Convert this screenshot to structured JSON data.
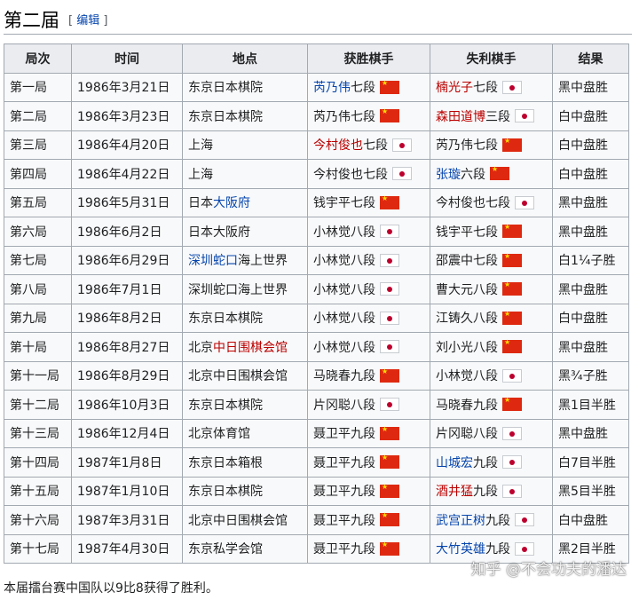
{
  "section": {
    "title": "第二届",
    "edit_bracket_open": "[",
    "edit_label": "编辑",
    "edit_bracket_close": "]"
  },
  "table": {
    "headers": [
      "局次",
      "时间",
      "地点",
      "获胜棋手",
      "失利棋手",
      "结果"
    ],
    "rows": [
      {
        "round": "第一局",
        "date": "1986年3月21日",
        "place": [
          {
            "t": "东京日本棋院"
          }
        ],
        "winner": {
          "parts": [
            {
              "t": "芮乃伟",
              "link": "blue"
            },
            {
              "t": "七段"
            }
          ],
          "flag": "cn"
        },
        "loser": {
          "parts": [
            {
              "t": "楠光子",
              "link": "red"
            },
            {
              "t": "七段"
            }
          ],
          "flag": "jp"
        },
        "result": "黑中盘胜"
      },
      {
        "round": "第二局",
        "date": "1986年3月23日",
        "place": [
          {
            "t": "东京日本棋院"
          }
        ],
        "winner": {
          "parts": [
            {
              "t": "芮乃伟七段"
            }
          ],
          "flag": "cn"
        },
        "loser": {
          "parts": [
            {
              "t": "森田道博",
              "link": "red"
            },
            {
              "t": "三段"
            }
          ],
          "flag": "jp"
        },
        "result": "白中盘胜"
      },
      {
        "round": "第三局",
        "date": "1986年4月20日",
        "place": [
          {
            "t": "上海"
          }
        ],
        "winner": {
          "parts": [
            {
              "t": "今村俊也",
              "link": "red"
            },
            {
              "t": "七段"
            }
          ],
          "flag": "jp"
        },
        "loser": {
          "parts": [
            {
              "t": "芮乃伟七段"
            }
          ],
          "flag": "cn"
        },
        "result": "白中盘胜"
      },
      {
        "round": "第四局",
        "date": "1986年4月22日",
        "place": [
          {
            "t": "上海"
          }
        ],
        "winner": {
          "parts": [
            {
              "t": "今村俊也七段"
            }
          ],
          "flag": "jp"
        },
        "loser": {
          "parts": [
            {
              "t": "张璇",
              "link": "blue"
            },
            {
              "t": "六段"
            }
          ],
          "flag": "cn"
        },
        "result": "白中盘胜"
      },
      {
        "round": "第五局",
        "date": "1986年5月31日",
        "place": [
          {
            "t": "日本"
          },
          {
            "t": "大阪府",
            "link": "blue"
          }
        ],
        "winner": {
          "parts": [
            {
              "t": "钱宇平七段"
            }
          ],
          "flag": "cn"
        },
        "loser": {
          "parts": [
            {
              "t": "今村俊也七段"
            }
          ],
          "flag": "jp"
        },
        "result": "黑中盘胜"
      },
      {
        "round": "第六局",
        "date": "1986年6月2日",
        "place": [
          {
            "t": "日本大阪府"
          }
        ],
        "winner": {
          "parts": [
            {
              "t": "小林觉八段"
            }
          ],
          "flag": "jp"
        },
        "loser": {
          "parts": [
            {
              "t": "钱宇平七段"
            }
          ],
          "flag": "cn"
        },
        "result": "黑中盘胜"
      },
      {
        "round": "第七局",
        "date": "1986年6月29日",
        "place": [
          {
            "t": "深圳",
            "link": "blue"
          },
          {
            "t": "蛇口",
            "link": "blue"
          },
          {
            "t": "海上世界"
          }
        ],
        "winner": {
          "parts": [
            {
              "t": "小林觉八段"
            }
          ],
          "flag": "jp"
        },
        "loser": {
          "parts": [
            {
              "t": "邵震中七段"
            }
          ],
          "flag": "cn"
        },
        "result": "白1¼子胜"
      },
      {
        "round": "第八局",
        "date": "1986年7月1日",
        "place": [
          {
            "t": "深圳蛇口海上世界"
          }
        ],
        "winner": {
          "parts": [
            {
              "t": "小林觉八段"
            }
          ],
          "flag": "jp"
        },
        "loser": {
          "parts": [
            {
              "t": "曹大元八段"
            }
          ],
          "flag": "cn"
        },
        "result": "黑中盘胜"
      },
      {
        "round": "第九局",
        "date": "1986年8月2日",
        "place": [
          {
            "t": "东京日本棋院"
          }
        ],
        "winner": {
          "parts": [
            {
              "t": "小林觉八段"
            }
          ],
          "flag": "jp"
        },
        "loser": {
          "parts": [
            {
              "t": "江铸久八段"
            }
          ],
          "flag": "cn"
        },
        "result": "白中盘胜"
      },
      {
        "round": "第十局",
        "date": "1986年8月27日",
        "place": [
          {
            "t": "北京"
          },
          {
            "t": "中日围棋会馆",
            "link": "red"
          }
        ],
        "winner": {
          "parts": [
            {
              "t": "小林觉八段"
            }
          ],
          "flag": "jp"
        },
        "loser": {
          "parts": [
            {
              "t": "刘小光八段"
            }
          ],
          "flag": "cn"
        },
        "result": "黑中盘胜"
      },
      {
        "round": "第十一局",
        "date": "1986年8月29日",
        "place": [
          {
            "t": "北京中日围棋会馆"
          }
        ],
        "winner": {
          "parts": [
            {
              "t": "马晓春九段"
            }
          ],
          "flag": "cn"
        },
        "loser": {
          "parts": [
            {
              "t": "小林觉八段"
            }
          ],
          "flag": "jp"
        },
        "result": "黑¾子胜"
      },
      {
        "round": "第十二局",
        "date": "1986年10月3日",
        "place": [
          {
            "t": "东京日本棋院"
          }
        ],
        "winner": {
          "parts": [
            {
              "t": "片冈聪八段"
            }
          ],
          "flag": "jp"
        },
        "loser": {
          "parts": [
            {
              "t": "马晓春九段"
            }
          ],
          "flag": "cn"
        },
        "result": "黑1目半胜"
      },
      {
        "round": "第十三局",
        "date": "1986年12月4日",
        "place": [
          {
            "t": "北京体育馆"
          }
        ],
        "winner": {
          "parts": [
            {
              "t": "聂卫平九段"
            }
          ],
          "flag": "cn"
        },
        "loser": {
          "parts": [
            {
              "t": "片冈聪八段"
            }
          ],
          "flag": "jp"
        },
        "result": "黑中盘胜"
      },
      {
        "round": "第十四局",
        "date": "1987年1月8日",
        "place": [
          {
            "t": "东京日本箱根"
          }
        ],
        "winner": {
          "parts": [
            {
              "t": "聂卫平九段"
            }
          ],
          "flag": "cn"
        },
        "loser": {
          "parts": [
            {
              "t": "山城宏",
              "link": "blue"
            },
            {
              "t": "九段"
            }
          ],
          "flag": "jp"
        },
        "result": "白7目半胜"
      },
      {
        "round": "第十五局",
        "date": "1987年1月10日",
        "place": [
          {
            "t": "东京日本棋院"
          }
        ],
        "winner": {
          "parts": [
            {
              "t": "聂卫平九段"
            }
          ],
          "flag": "cn"
        },
        "loser": {
          "parts": [
            {
              "t": "酒井猛",
              "link": "red"
            },
            {
              "t": "九段"
            }
          ],
          "flag": "jp"
        },
        "result": "黑5目半胜"
      },
      {
        "round": "第十六局",
        "date": "1987年3月31日",
        "place": [
          {
            "t": "北京中日围棋会馆"
          }
        ],
        "winner": {
          "parts": [
            {
              "t": "聂卫平九段"
            }
          ],
          "flag": "cn"
        },
        "loser": {
          "parts": [
            {
              "t": "武宫正树",
              "link": "blue"
            },
            {
              "t": "九段"
            }
          ],
          "flag": "jp"
        },
        "result": "白中盘胜"
      },
      {
        "round": "第十七局",
        "date": "1987年4月30日",
        "place": [
          {
            "t": "东京私学会馆"
          }
        ],
        "winner": {
          "parts": [
            {
              "t": "聂卫平九段"
            }
          ],
          "flag": "cn"
        },
        "loser": {
          "parts": [
            {
              "t": "大竹英雄",
              "link": "blue"
            },
            {
              "t": "九段"
            }
          ],
          "flag": "jp"
        },
        "result": "黑2目半胜"
      }
    ]
  },
  "watermark": "知乎 @不会功夫的潘达",
  "summary": "本届擂台赛中国队以9比8获得了胜利。",
  "colors": {
    "link": "#0645ad",
    "redlink": "#ba0000",
    "header_bg": "#eaecf0",
    "cell_bg": "#f8f9fa",
    "border": "#a2a9b1"
  }
}
